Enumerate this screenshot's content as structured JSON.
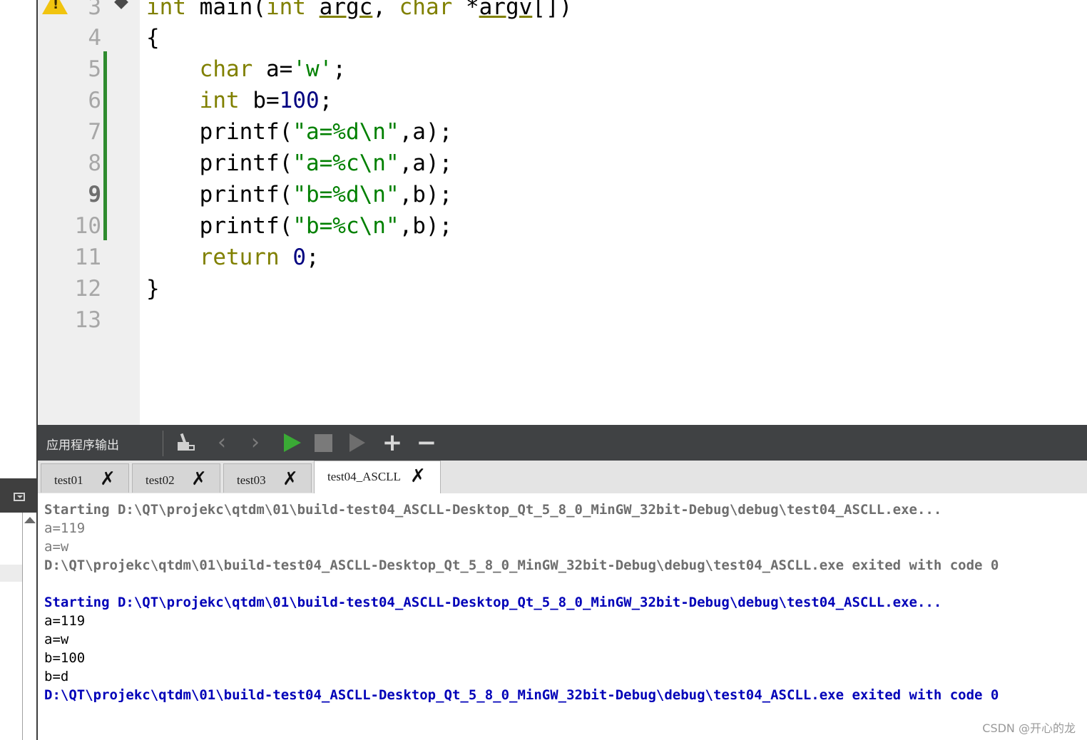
{
  "editor": {
    "line_numbers": [
      "3",
      "4",
      "5",
      "6",
      "7",
      "8",
      "9",
      "10",
      "11",
      "12",
      "13"
    ],
    "current_line": "9",
    "code": {
      "l3": {
        "kw1": "int",
        "fn": " main(",
        "kw2": "int",
        "sp": " ",
        "argc": "argc",
        "comma": ", ",
        "kw3": "char",
        "star": " *",
        "argv": "argv",
        "tail": "[])"
      },
      "l4": "{",
      "l5": {
        "indent": "    ",
        "kw": "char",
        "rest": " a=",
        "str": "'w'",
        "end": ";"
      },
      "l6": {
        "indent": "    ",
        "kw": "int",
        "rest": " b=",
        "num": "100",
        "end": ";"
      },
      "l7": {
        "indent": "    ",
        "fn": "printf(",
        "str": "\"a=%d\\n\"",
        "end": ",a);"
      },
      "l8": {
        "indent": "    ",
        "fn": "printf(",
        "str": "\"a=%c\\n\"",
        "end": ",a);"
      },
      "l9": {
        "indent": "    ",
        "fn": "printf(",
        "str": "\"b=%d\\n\"",
        "end": ",b);"
      },
      "l10": {
        "indent": "    ",
        "fn": "printf(",
        "str": "\"b=%c\\n\"",
        "end": ",b);"
      },
      "l11": {
        "indent": "    ",
        "kw": "return",
        "sp": " ",
        "num": "0",
        "end": ";"
      },
      "l12": "}"
    }
  },
  "output_pane": {
    "title": "应用程序输出",
    "toolbar_icons": [
      "clean-output-icon",
      "previous-icon",
      "next-icon",
      "run-icon",
      "stop-icon",
      "attach-debugger-icon",
      "zoom-in-icon",
      "zoom-out-icon"
    ],
    "tabs": [
      {
        "label": "test01",
        "active": false
      },
      {
        "label": "test02",
        "active": false
      },
      {
        "label": "test03",
        "active": false
      },
      {
        "label": "test04_ASCLL",
        "active": true
      }
    ],
    "lines": [
      "Starting D:\\QT\\projekc\\qtdm\\01\\build-test04_ASCLL-Desktop_Qt_5_8_0_MinGW_32bit-Debug\\debug\\test04_ASCLL.exe...",
      "a=119",
      "a=w",
      "D:\\QT\\projekc\\qtdm\\01\\build-test04_ASCLL-Desktop_Qt_5_8_0_MinGW_32bit-Debug\\debug\\test04_ASCLL.exe exited with code 0",
      "Starting D:\\QT\\projekc\\qtdm\\01\\build-test04_ASCLL-Desktop_Qt_5_8_0_MinGW_32bit-Debug\\debug\\test04_ASCLL.exe...",
      "a=119",
      "a=w",
      "b=100",
      "b=d",
      "D:\\QT\\projekc\\qtdm\\01\\build-test04_ASCLL-Desktop_Qt_5_8_0_MinGW_32bit-Debug\\debug\\test04_ASCLL.exe exited with code 0"
    ]
  },
  "colors": {
    "keyword": "#808000",
    "string": "#008000",
    "number": "#000080",
    "output_blue": "#0000b8",
    "change_bar": "#2e8b2e"
  },
  "watermark": "CSDN @开心的龙"
}
